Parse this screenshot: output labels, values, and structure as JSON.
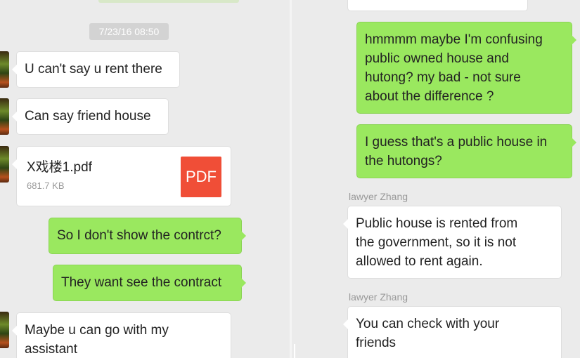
{
  "left": {
    "timestamp": "7/23/16 08:50",
    "messages": [
      {
        "text": "U can't say u rent there"
      },
      {
        "text": "Can say friend house"
      },
      {
        "file_name": "X戏楼1.pdf",
        "file_size": "681.7 KB",
        "file_icon": "PDF"
      },
      {
        "text": "So I don't show the contrct?"
      },
      {
        "text": "They want see the contract"
      },
      {
        "line1": "Maybe u can go with my",
        "line2": "assistant"
      }
    ]
  },
  "right": {
    "messages": [
      {
        "lines": [
          "hmmmm maybe I'm confusing",
          "public owned house and",
          "hutong? my bad - not sure",
          "about the difference ?"
        ]
      },
      {
        "lines": [
          "I guess that's a public house in",
          "the hutongs?"
        ]
      },
      {
        "sender": "lawyer Zhang",
        "lines": [
          "Public house is rented from",
          "the government, so it is not",
          "allowed to rent again."
        ]
      },
      {
        "sender": "lawyer Zhang",
        "lines": [
          "You can check with your",
          "friends"
        ]
      }
    ]
  },
  "colors": {
    "background": "#ebebeb",
    "incoming_bubble": "#ffffff",
    "outgoing_bubble": "#9ae85f",
    "pdf_icon": "#f04e37",
    "timestamp_chip": "#d3d3d3",
    "sender_name": "#999999"
  }
}
